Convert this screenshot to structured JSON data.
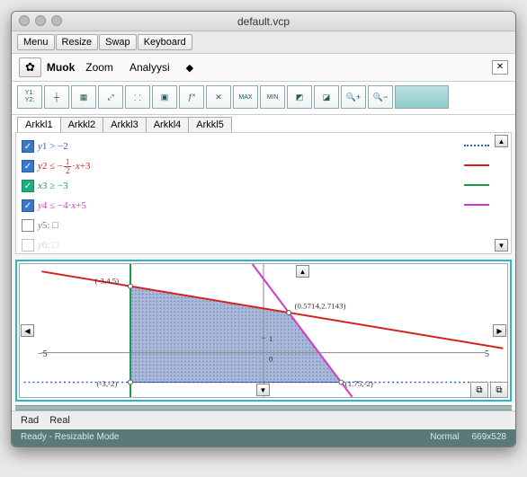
{
  "window": {
    "title": "default.vcp"
  },
  "buttons": {
    "menu": "Menu",
    "resize": "Resize",
    "swap": "Swap",
    "keyboard": "Keyboard"
  },
  "menubar": {
    "muok": "Muok",
    "zoom": "Zoom",
    "analyysi": "Analyysi"
  },
  "toolbar_icons": [
    "Y1=\nY2=",
    "axes",
    "grid",
    "fit",
    "dot",
    "box",
    "fx",
    "xint",
    "MAX",
    "MIN",
    "sel1",
    "sel2",
    "zin",
    "zout"
  ],
  "tabs": [
    "Arkkl1",
    "Arkkl2",
    "Arkkl3",
    "Arkkl4",
    "Arkkl5"
  ],
  "functions": [
    {
      "check": "v",
      "label_html": [
        "y1",
        ">",
        "−2"
      ],
      "color": "#2a5ce0",
      "style": "dashblue"
    },
    {
      "check": "v",
      "label_html": [
        "y2",
        "≤",
        "−",
        "frac12",
        "·x+3"
      ],
      "color": "#d42222",
      "style": "solidred"
    },
    {
      "check": "vg",
      "label_html": [
        "x3",
        "≥",
        "−3"
      ],
      "color": "#1a9a4a",
      "style": "solidgreen"
    },
    {
      "check": "v",
      "label_html": [
        "y4",
        "≤",
        "−4·x+5"
      ],
      "color": "#d438c8",
      "style": "solidmagenta"
    },
    {
      "check": "",
      "label_html": [
        "y5",
        ":",
        "□"
      ],
      "color": "#999",
      "style": ""
    },
    {
      "check": "",
      "label_html": [
        "y6",
        ":",
        "□"
      ],
      "color": "#bbb",
      "style": ""
    }
  ],
  "graph": {
    "xmin_label": "−5",
    "xmax_label": "5",
    "points": [
      {
        "text": "(-3,4.5)",
        "x": -3,
        "y": 4.5
      },
      {
        "text": "(0.5714,2.7143)",
        "x": 0.5714,
        "y": 2.7143
      },
      {
        "text": "(-3,-2)",
        "x": -3,
        "y": -2
      },
      {
        "text": "(1.75,-2)",
        "x": 1.75,
        "y": -2
      }
    ],
    "ytick": "1",
    "origin": "0"
  },
  "status": {
    "rad": "Rad",
    "real": "Real",
    "ready": "Ready - Resizable Mode",
    "normal": "Normal",
    "dims": "669x528"
  },
  "chart_data": {
    "type": "area",
    "title": "",
    "xlabel": "",
    "ylabel": "",
    "xlim": [
      -5,
      5
    ],
    "ylim": [
      -3,
      6
    ],
    "series": [
      {
        "name": "y1 > -2",
        "type": "hline",
        "y": -2,
        "style": "dotted",
        "color": "#2a5ce0"
      },
      {
        "name": "y2 ≤ -1/2·x+3",
        "type": "line",
        "slope": -0.5,
        "intercept": 3,
        "color": "#d42222"
      },
      {
        "name": "x3 ≥ -3",
        "type": "vline",
        "x": -3,
        "color": "#1a9a4a"
      },
      {
        "name": "y4 ≤ -4·x+5",
        "type": "line",
        "slope": -4,
        "intercept": 5,
        "color": "#d438c8"
      }
    ],
    "feasible_region_vertices": [
      {
        "x": -3,
        "y": 4.5
      },
      {
        "x": 0.5714,
        "y": 2.7143
      },
      {
        "x": 1.75,
        "y": -2
      },
      {
        "x": -3,
        "y": -2
      }
    ]
  }
}
